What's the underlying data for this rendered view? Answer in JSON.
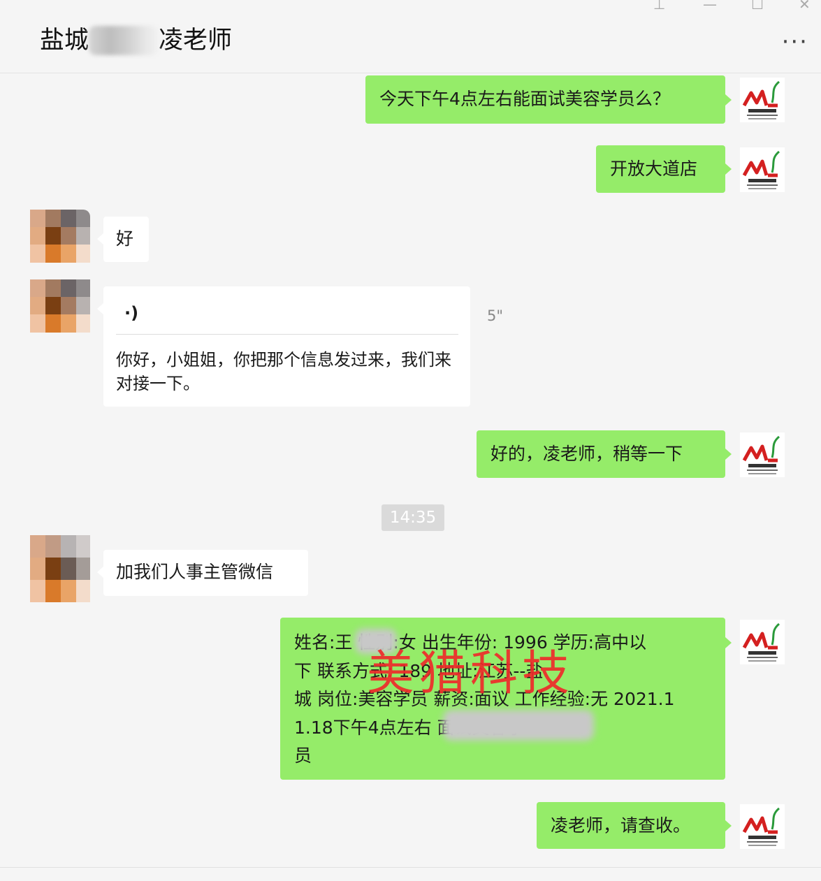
{
  "header": {
    "title_left": "盐城",
    "title_right": "凌老师",
    "window_controls": [
      "pin-icon",
      "minimize-icon",
      "maximize-icon",
      "close-icon"
    ]
  },
  "messages": [
    {
      "side": "right",
      "text": "今天下午4点左右能面试美容学员么？"
    },
    {
      "side": "right",
      "text": "开放大道店"
    },
    {
      "side": "left",
      "text": "好"
    },
    {
      "side": "left",
      "type": "voice",
      "duration": "5\"",
      "transcript": "你好，小姐姐，你把那个信息发过来，我们来对接一下。"
    },
    {
      "side": "right",
      "text": "好的，凌老师，稍等一下"
    },
    {
      "side": "left",
      "text": "加我们人事主管微信"
    },
    {
      "side": "right",
      "lines": [
        "姓名:王  性别:女 出生年份: 1996 学历:高中以",
        "下 联系方式: 189      地址:江苏--盐",
        "城 岗位:美容学员 薪资:面议 工作经验:无 2021.1",
        "1.18下午4点左右            面试美容学",
        "员"
      ]
    },
    {
      "side": "right",
      "text": "凌老师，请查收。"
    }
  ],
  "timestamp": "14:35",
  "watermark": "美猎科技",
  "colors": {
    "green_bubble": "#95ec69",
    "white_bubble": "#ffffff",
    "background": "#f5f5f5",
    "watermark": "#ee2b2b"
  },
  "avatar_right_caption": "美猎科技"
}
